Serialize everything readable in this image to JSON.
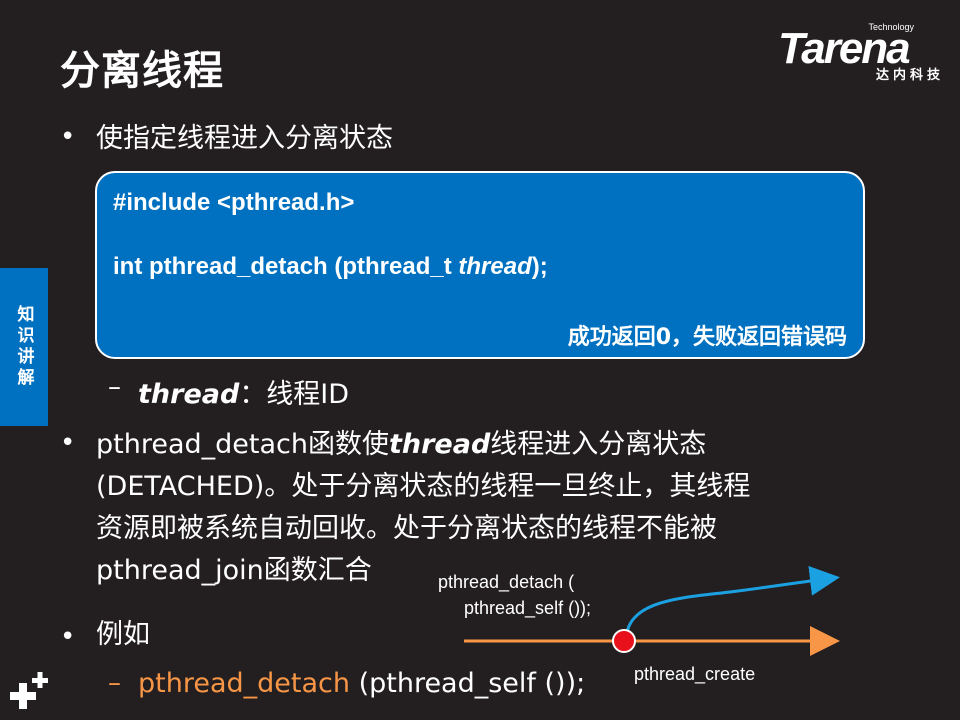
{
  "slide": {
    "title": "分离线程",
    "logo": {
      "small": "Technology",
      "word": "Tarena",
      "sub": "达内科技"
    },
    "side_tab": "知识讲解",
    "bullet1": "使指定线程进入分离状态",
    "code": {
      "line1": "#include <pthread.h>",
      "line2_prefix": "int pthread_detach (pthread_t ",
      "line2_param": "thread",
      "line2_suffix": ");",
      "return_note": "成功返回0，失败返回错误码"
    },
    "param": {
      "dash": "–",
      "name": "thread",
      "desc": "：线程ID"
    },
    "bullet2": {
      "line1_prefix": "pthread_detach函数使",
      "line1_param": "thread",
      "line1_suffix": "线程进入分离状态",
      "line2": "(DETACHED)。处于分离状态的线程一旦终止，其线程",
      "line3": "资源即被系统自动回收。处于分离状态的线程不能被",
      "line4": "pthread_join函数汇合"
    },
    "bullet3": "例如",
    "example": {
      "dash": "–",
      "func": "pthread_detach",
      "rest": " (pthread_self ());"
    },
    "bullet_symbol": "•",
    "diagram": {
      "detach_label_1": "pthread_detach (",
      "detach_label_2": "pthread_self ());",
      "create_label": "pthread_create"
    },
    "colors": {
      "background": "#231f20",
      "box": "#0070c0",
      "accent_orange": "#f79646",
      "arrow_blue": "#1ba1e2",
      "dot_red": "#e8111b"
    }
  }
}
